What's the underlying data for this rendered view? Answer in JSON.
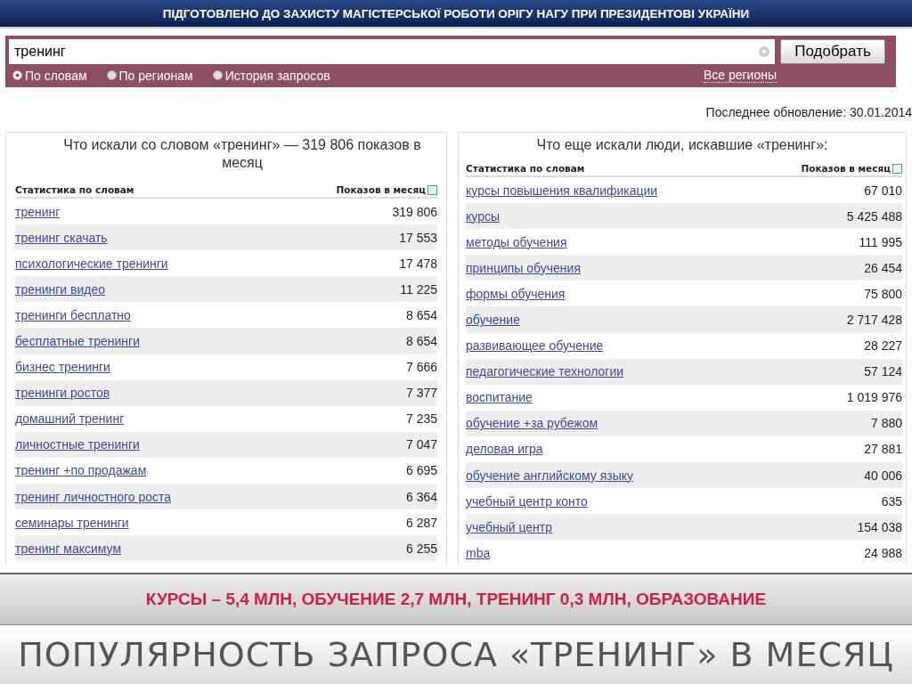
{
  "header": {
    "title": "ПІДГОТОВЛЕНО ДО ЗАХИСТУ МАГІСТЕРСЬКОЇ РОБОТИ ОРІГУ НАГУ ПРИ ПРЕЗИДЕНТОВІ УКРАЇНИ"
  },
  "search": {
    "value": "тренинг",
    "button": "Подобрать",
    "modes": [
      {
        "label": "По словам",
        "selected": true
      },
      {
        "label": "По регионам",
        "selected": false
      },
      {
        "label": "История запросов",
        "selected": false
      }
    ],
    "regions_link": "Все регионы"
  },
  "last_update": "Последнее обновление: 30.01.2014",
  "panels": [
    {
      "title": "Что искали со словом «тренинг» — 319 806 показов в месяц",
      "columns": [
        "Статистика по словам",
        "Показов в месяц"
      ],
      "rows": [
        {
          "phrase": "тренинг",
          "count": "319 806"
        },
        {
          "phrase": "тренинг скачать",
          "count": "17 553"
        },
        {
          "phrase": "психологические тренинги",
          "count": "17 478"
        },
        {
          "phrase": "тренинги видео",
          "count": "11 225"
        },
        {
          "phrase": "тренинги бесплатно",
          "count": "8 654"
        },
        {
          "phrase": "бесплатные тренинги",
          "count": "8 654"
        },
        {
          "phrase": "бизнес тренинги",
          "count": "7 666"
        },
        {
          "phrase": "тренинги ростов",
          "count": "7 377"
        },
        {
          "phrase": "домашний тренинг",
          "count": "7 235"
        },
        {
          "phrase": "личностные тренинги",
          "count": "7 047"
        },
        {
          "phrase": "тренинг +по продажам",
          "count": "6 695"
        },
        {
          "phrase": "тренинг личностного роста",
          "count": "6 364"
        },
        {
          "phrase": "семинары тренинги",
          "count": "6 287"
        },
        {
          "phrase": "тренинг максимум",
          "count": "6 255"
        }
      ]
    },
    {
      "title": "Что еще искали люди, искавшие «тренинг»:",
      "columns": [
        "Статистика по словам",
        "Показов в месяц"
      ],
      "rows": [
        {
          "phrase": "курсы повышения квалификации",
          "count": "67 010"
        },
        {
          "phrase": "курсы",
          "count": "5 425 488"
        },
        {
          "phrase": "методы обучения",
          "count": "111 995"
        },
        {
          "phrase": "принципы обучения",
          "count": "26 454"
        },
        {
          "phrase": "формы обучения",
          "count": "75 800"
        },
        {
          "phrase": "обучение",
          "count": "2 717 428"
        },
        {
          "phrase": "развивающее обучение",
          "count": "28 227"
        },
        {
          "phrase": "педагогические технологии",
          "count": "57 124"
        },
        {
          "phrase": "воспитание",
          "count": "1 019 976"
        },
        {
          "phrase": "обучение +за рубежом",
          "count": "7 880"
        },
        {
          "phrase": "деловая игра",
          "count": "27 881"
        },
        {
          "phrase": "обучение английскому языку",
          "count": "40 006"
        },
        {
          "phrase": "учебный центр конто",
          "count": "635"
        },
        {
          "phrase": "учебный центр",
          "count": "154 038"
        },
        {
          "phrase": "mba",
          "count": "24 988"
        }
      ]
    }
  ],
  "summary": "КУРСЫ – 5,4 МЛН, ОБУЧЕНИЕ 2,7 МЛН, ТРЕНИНГ 0,3 МЛН, ОБРАЗОВАНИЕ",
  "slide_title": "ПОПУЛЯРНОСТЬ ЗАПРОСА «ТРЕНИНГ» В МЕСЯЦ"
}
